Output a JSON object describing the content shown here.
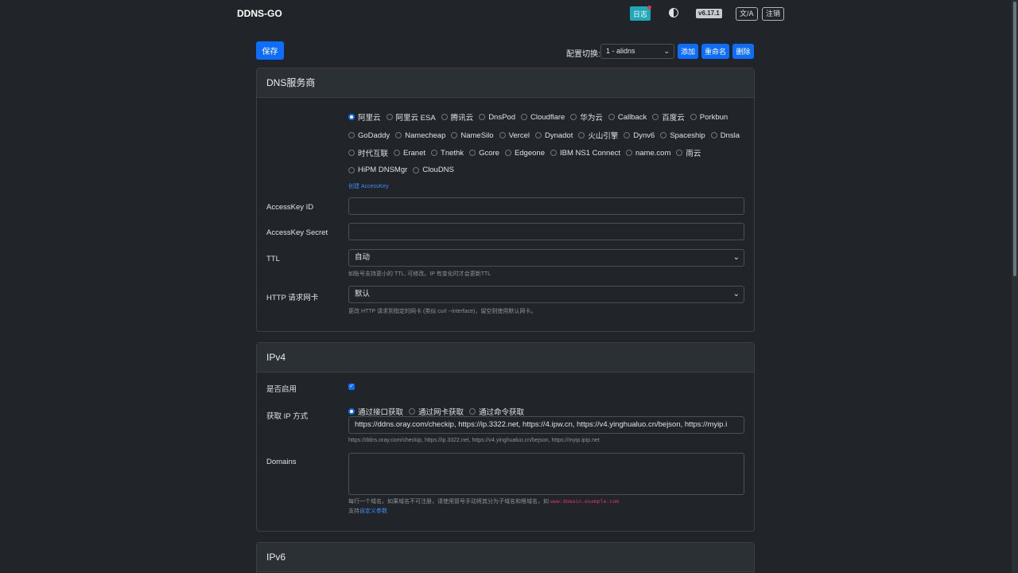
{
  "header": {
    "brand": "DDNS-GO",
    "log_label": "日志",
    "version": "v6.17.1",
    "lang_label": "文/A",
    "logout_label": "注销"
  },
  "toolbar": {
    "save_label": "保存",
    "config_label": "配置切换:",
    "config_value": "1 - alidns",
    "add_label": "添加",
    "rename_label": "重命名",
    "delete_label": "删除"
  },
  "dns_card": {
    "title": "DNS服务商",
    "providers_row1": [
      "阿里云",
      "阿里云 ESA",
      "腾讯云",
      "DnsPod",
      "Cloudflare",
      "华为云",
      "Callback",
      "百度云",
      "Porkbun"
    ],
    "providers_row2": [
      "GoDaddy",
      "Namecheap",
      "NameSilo",
      "Vercel",
      "Dynadot",
      "火山引擎",
      "Dynv6",
      "Spaceship",
      "Dnsla"
    ],
    "providers_row3": [
      "时代互联",
      "Eranet",
      "Tnethk",
      "Gcore",
      "Edgeone",
      "IBM NS1 Connect",
      "name.com",
      "雨云"
    ],
    "providers_row4": [
      "HiPM DNSMgr",
      "ClouDNS"
    ],
    "selected": "阿里云",
    "create_key_link": "创建 AccessKey",
    "access_key_id_label": "AccessKey ID",
    "access_key_secret_label": "AccessKey Secret",
    "ttl_label": "TTL",
    "ttl_value": "自动",
    "ttl_help": "如账号支持更小的 TTL, 可修改。IP 有变化时才会更新TTL",
    "nic_label": "HTTP 请求网卡",
    "nic_value": "默认",
    "nic_help": "更改 HTTP 请求到指定的网卡 (类似 curl --interface)，留空则使用默认网卡。"
  },
  "ipv4_card": {
    "title": "IPv4",
    "enable_label": "是否启用",
    "enabled": true,
    "method_label": "获取 IP 方式",
    "methods": [
      "通过接口获取",
      "通过网卡获取",
      "通过命令获取"
    ],
    "method_selected": "通过接口获取",
    "url_value": "https://ddns.oray.com/checkip, https://ip.3322.net, https://4.ipw.cn, https://v4.yinghualuo.cn/bejson, https://myip.i",
    "url_help": "https://ddns.oray.com/checkip, https://ip.3322.net, https://v4.yinghualuo.cn/bejson, https://myip.ipip.net",
    "domains_label": "Domains",
    "domains_help": "每行一个域名。如果域名不可注册，请使用冒号手动将其分为子域名和根域名，如",
    "domains_help_code": "www:domain.example.com",
    "domains_support_prefix": "支持",
    "domains_support_link": "自定义参数"
  },
  "ipv6_card": {
    "title": "IPv6"
  }
}
